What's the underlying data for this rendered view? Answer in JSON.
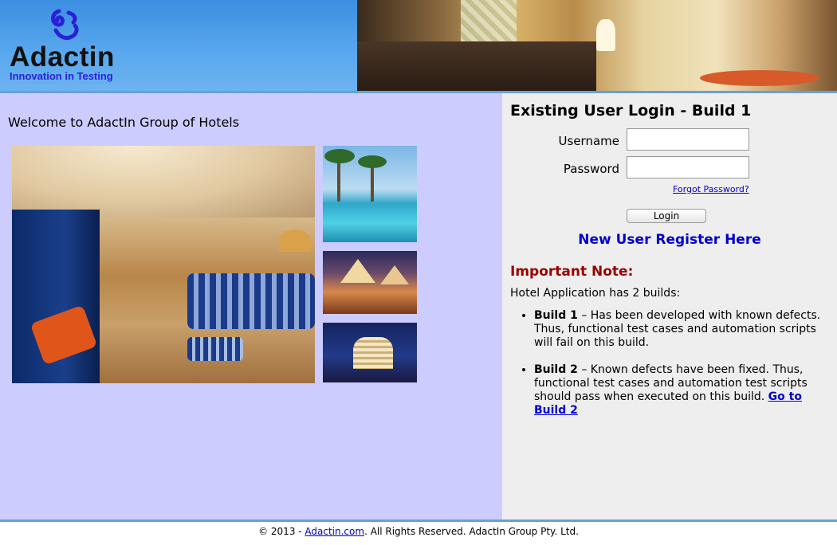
{
  "brand": {
    "logo_text": "Adactin",
    "tagline": "Innovation in Testing"
  },
  "welcome_text": "Welcome to AdactIn Group of Hotels",
  "login": {
    "title": "Existing User Login - Build 1",
    "username_label": "Username",
    "password_label": "Password",
    "username_value": "",
    "password_value": "",
    "forgot_password": "Forgot Password?",
    "login_button": "Login",
    "register_link": "New User Register Here"
  },
  "note": {
    "title": "Important Note:",
    "intro": "Hotel Application has 2 builds:",
    "builds": [
      {
        "name": "Build 1",
        "text": " – Has been developed with known defects. Thus, functional test cases and automation scripts will fail on this build."
      },
      {
        "name": "Build 2",
        "text": " – Known defects have been fixed. Thus, functional test cases and automation test scripts should pass when executed on this build. ",
        "link": "Go to Build 2"
      }
    ]
  },
  "footer": {
    "prefix": "© 2013 - ",
    "link": "Adactin.com",
    "suffix": ". All Rights Reserved. AdactIn Group Pty. Ltd."
  },
  "colors": {
    "left_panel_bg": "#ccccff",
    "right_panel_bg": "#eeeeee",
    "link_blue": "#0000cc",
    "note_red": "#990000",
    "header_blue": "#4a9ce8"
  },
  "icons": {
    "logo": "adactin-swirl-logo"
  }
}
